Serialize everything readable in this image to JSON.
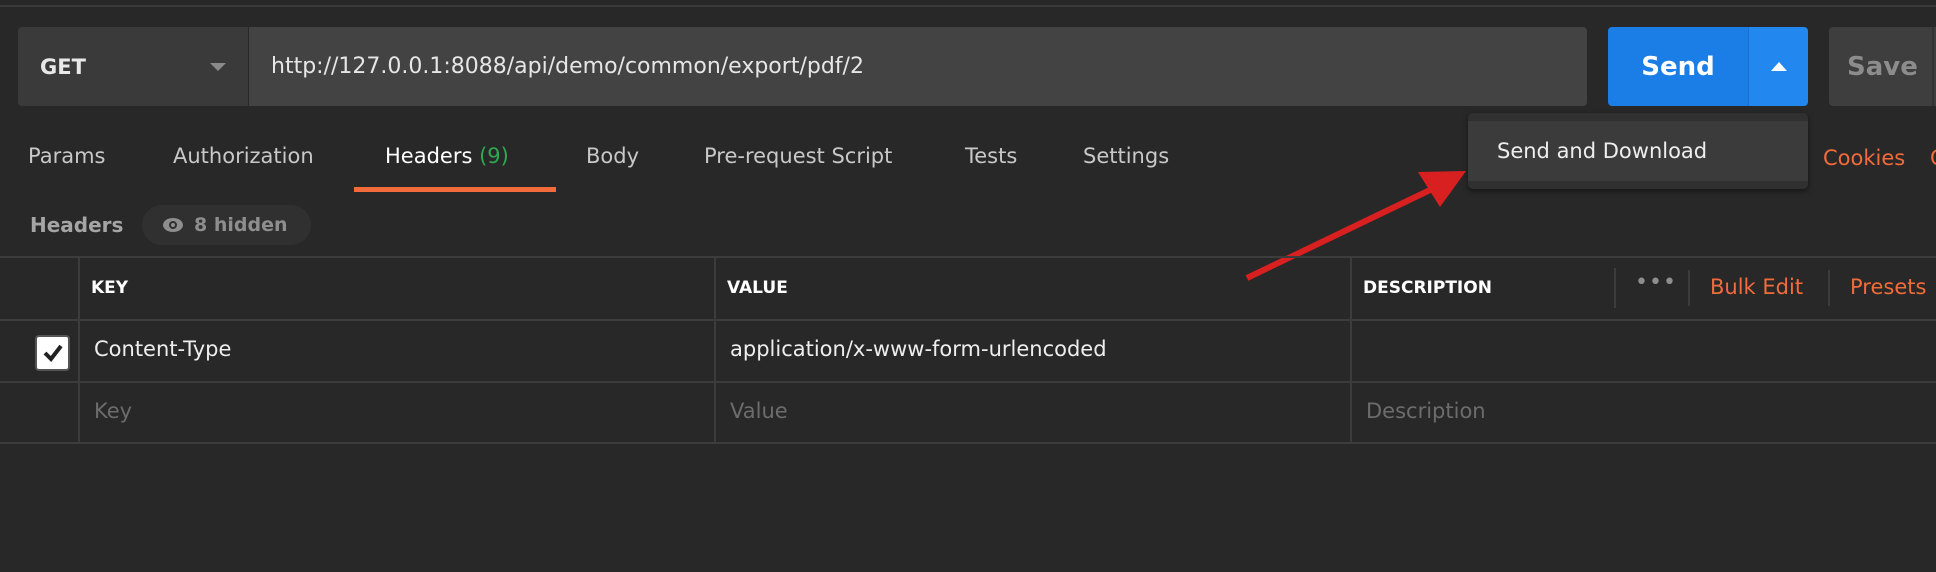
{
  "request": {
    "method": "GET",
    "url": "http://127.0.0.1:8088/api/demo/common/export/pdf/2"
  },
  "buttons": {
    "send": "Send",
    "save": "Save"
  },
  "dropdown": {
    "items": [
      "Send and Download"
    ]
  },
  "tabs": [
    {
      "label": "Params"
    },
    {
      "label": "Authorization"
    },
    {
      "label": "Headers",
      "count": "(9)",
      "active": true
    },
    {
      "label": "Body"
    },
    {
      "label": "Pre-request Script"
    },
    {
      "label": "Tests"
    },
    {
      "label": "Settings"
    }
  ],
  "links": {
    "cookies": "Cookies",
    "code": "C"
  },
  "headers_section": {
    "title": "Headers",
    "hidden": "8 hidden"
  },
  "table": {
    "columns": [
      "KEY",
      "VALUE",
      "DESCRIPTION"
    ],
    "actions": {
      "more": "•••",
      "bulk_edit": "Bulk Edit",
      "presets": "Presets"
    },
    "rows": [
      {
        "checked": true,
        "key": "Content-Type",
        "value": "application/x-www-form-urlencoded",
        "description": ""
      }
    ],
    "placeholders": {
      "key": "Key",
      "value": "Value",
      "description": "Description"
    }
  },
  "colors": {
    "accent": "#f26b3a",
    "send": "#1b7ee6",
    "count": "#2fa84f",
    "annotation_arrow": "#d92020"
  }
}
